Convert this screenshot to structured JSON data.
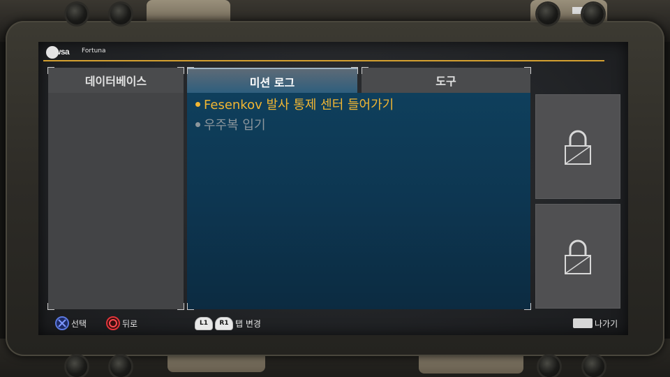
{
  "header": {
    "logo": "wsa",
    "app_title": "Fortuna"
  },
  "tabs": [
    {
      "label": "데이터베이스",
      "active": false
    },
    {
      "label": "미션 로그",
      "active": true
    },
    {
      "label": "도구",
      "active": false
    }
  ],
  "missions": [
    {
      "text": "Fesenkov 발사 통제 센터 들어가기",
      "state": "current"
    },
    {
      "text": "우주복 입기",
      "state": "inactive"
    }
  ],
  "tool_slots": [
    {
      "icon": "padlock-icon",
      "locked": true
    },
    {
      "icon": "padlock-icon",
      "locked": true
    }
  ],
  "footer": {
    "select_label": "선택",
    "back_label": "뒤로",
    "l1_label": "L1",
    "r1_label": "R1",
    "tab_change_label": "탭 변경",
    "exit_label": "나가기"
  },
  "colors": {
    "accent": "#f2b632",
    "mission_panel": "#0f3f5c",
    "inactive_text": "#8c969c",
    "cross_button": "#5b79e0",
    "circle_button": "#e0343a"
  }
}
